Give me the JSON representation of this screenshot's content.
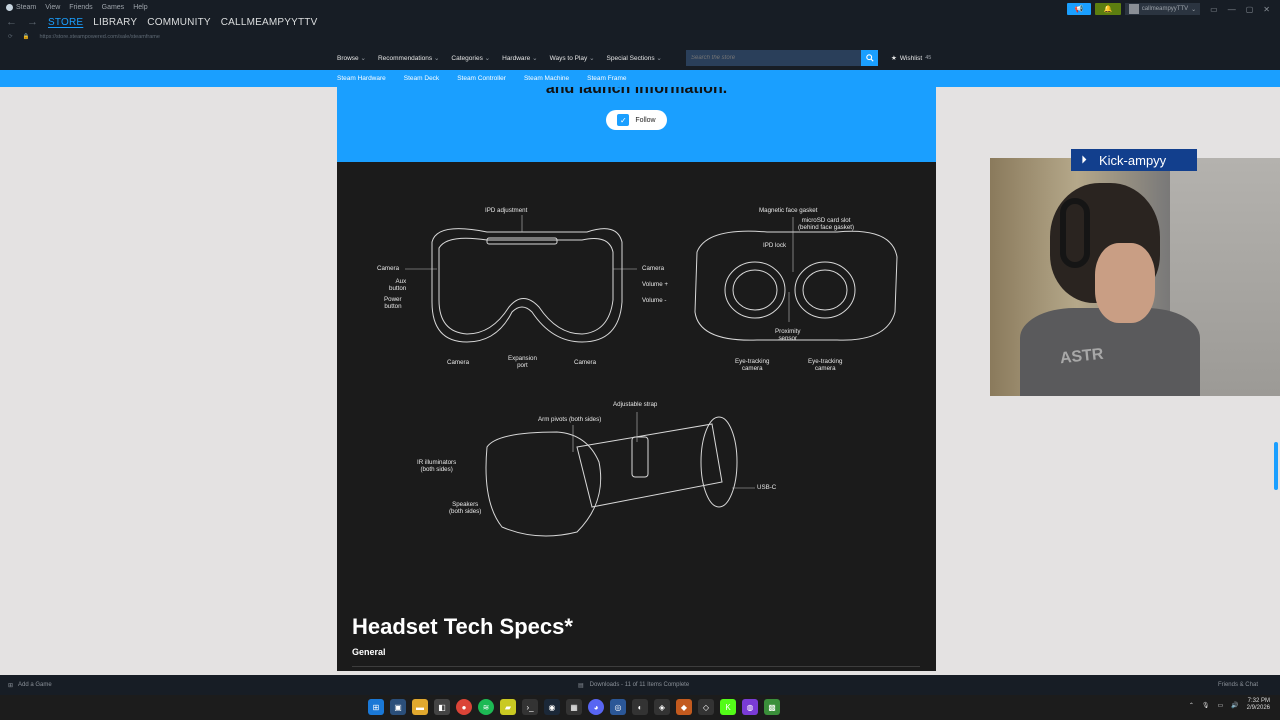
{
  "window": {
    "menu": [
      "Steam",
      "View",
      "Friends",
      "Games",
      "Help"
    ],
    "nav_tabs": [
      "STORE",
      "LIBRARY",
      "COMMUNITY",
      "CALLMEAMPYYTTV"
    ],
    "url": "https://store.steampowered.com/sale/steamframe",
    "username": "callmeampyyTTV"
  },
  "storenav": {
    "items": [
      "Browse",
      "Recommendations",
      "Categories",
      "Hardware",
      "Ways to Play",
      "Special Sections"
    ],
    "search_placeholder": "Search the store",
    "wishlist_label": "Wishlist",
    "wishlist_count": "45"
  },
  "subnav": {
    "items": [
      "Steam Hardware",
      "Steam Deck",
      "Steam Controller",
      "Steam Machine",
      "Steam Frame"
    ]
  },
  "banner": {
    "partial_heading": "and launch information.",
    "follow_label": "Follow"
  },
  "diagram": {
    "front": {
      "ipd_adjustment": "IPD adjustment",
      "camera_left": "Camera",
      "aux_button": "Aux\nbutton",
      "power_button": "Power\nbutton",
      "camera_right": "Camera",
      "volume_plus": "Volume +",
      "volume_minus": "Volume -",
      "camera_bottom_left": "Camera",
      "expansion_port": "Expansion\nport",
      "camera_bottom_right": "Camera"
    },
    "back": {
      "magnetic_face_gasket": "Magnetic face gasket",
      "microsd_slot": "microSD card slot\n(behind face gasket)",
      "ipd_lock": "IPD lock",
      "proximity_sensor": "Proximity\nsensor",
      "eye_tracking_left": "Eye-tracking\ncamera",
      "eye_tracking_right": "Eye-tracking\ncamera"
    },
    "side": {
      "adjustable_strap": "Adjustable strap",
      "arm_pivots": "Arm pivots (both sides)",
      "ir_illuminators": "IR illuminators\n(both sides)",
      "speakers": "Speakers\n(both sides)",
      "usb_c": "USB-C"
    }
  },
  "specs": {
    "title": "Headset Tech Specs*",
    "subtitle": "General"
  },
  "webcam": {
    "badge_label": "Kick-ampyy",
    "shirt_text": "ASTR"
  },
  "bottombar": {
    "add_game": "Add a Game",
    "downloads": "Downloads - 11 of 11 Items Complete",
    "friends_chat": "Friends & Chat"
  },
  "taskbar": {
    "time": "7:32 PM",
    "date": "2/9/2026"
  },
  "colors": {
    "steam_blue": "#1a9fff",
    "steam_dark": "#171d25",
    "content_dark": "#1b1b1b"
  }
}
